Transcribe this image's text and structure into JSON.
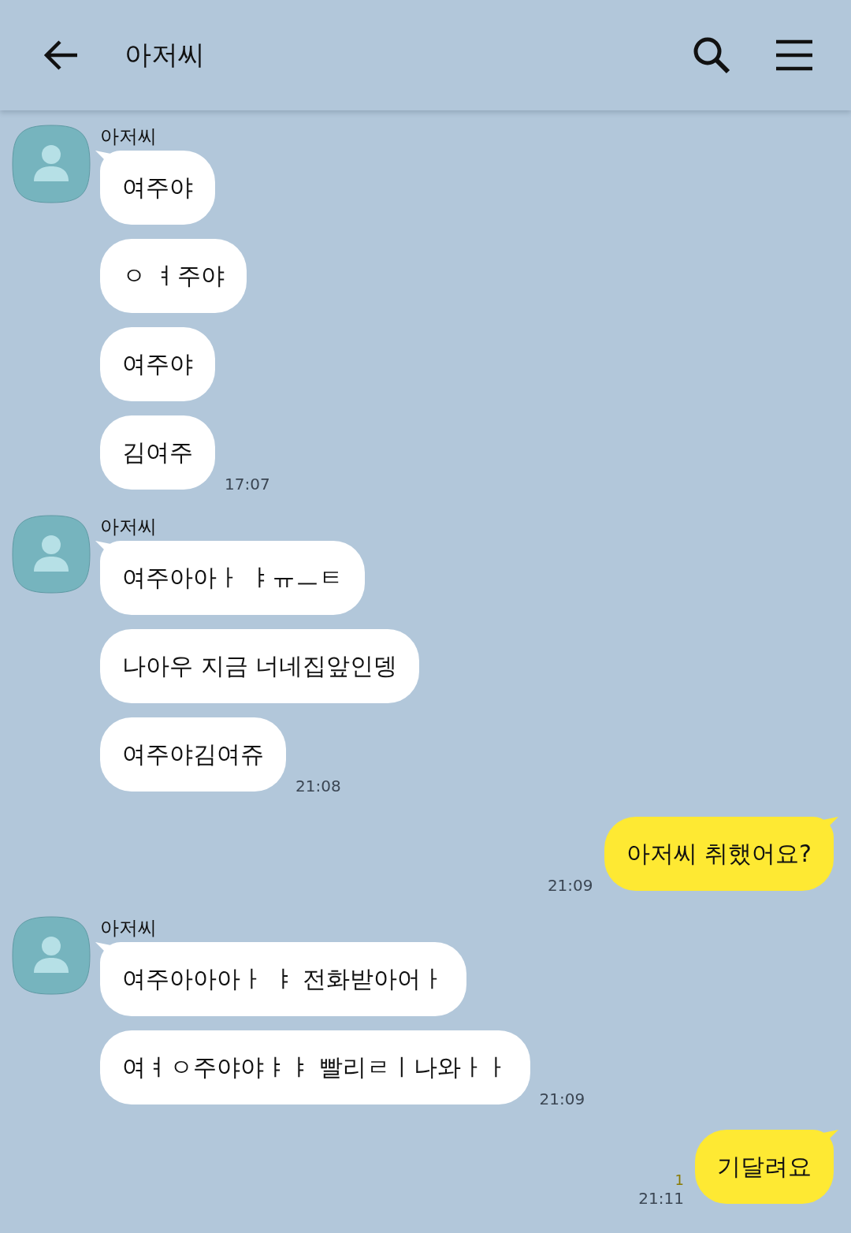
{
  "header": {
    "title": "아저씨"
  },
  "groups": [
    {
      "kind": "received",
      "sender": "아저씨",
      "messages": [
        "여주야",
        "ㅇ ㅕ주야",
        "여주야",
        "김여주"
      ],
      "time": "17:07"
    },
    {
      "kind": "received",
      "sender": "아저씨",
      "messages": [
        "여주아아ㅏ ㅑㅠㅡㅌ",
        "나아우 지금 너네집앞인뎅",
        "여주야김여쥬"
      ],
      "time": "21:08"
    },
    {
      "kind": "sent",
      "messages": [
        "아저씨 취했어요?"
      ],
      "time": "21:09"
    },
    {
      "kind": "received",
      "sender": "아저씨",
      "messages": [
        "여주아아아ㅏ ㅑ 전화받아어ㅏ",
        "여ㅕㅇ주야야ㅑㅑ 빨리ㄹㅣ나와ㅏㅏ"
      ],
      "time": "21:09"
    },
    {
      "kind": "sent",
      "messages": [
        "기달려요"
      ],
      "time": "21:11",
      "unread": "1"
    }
  ]
}
